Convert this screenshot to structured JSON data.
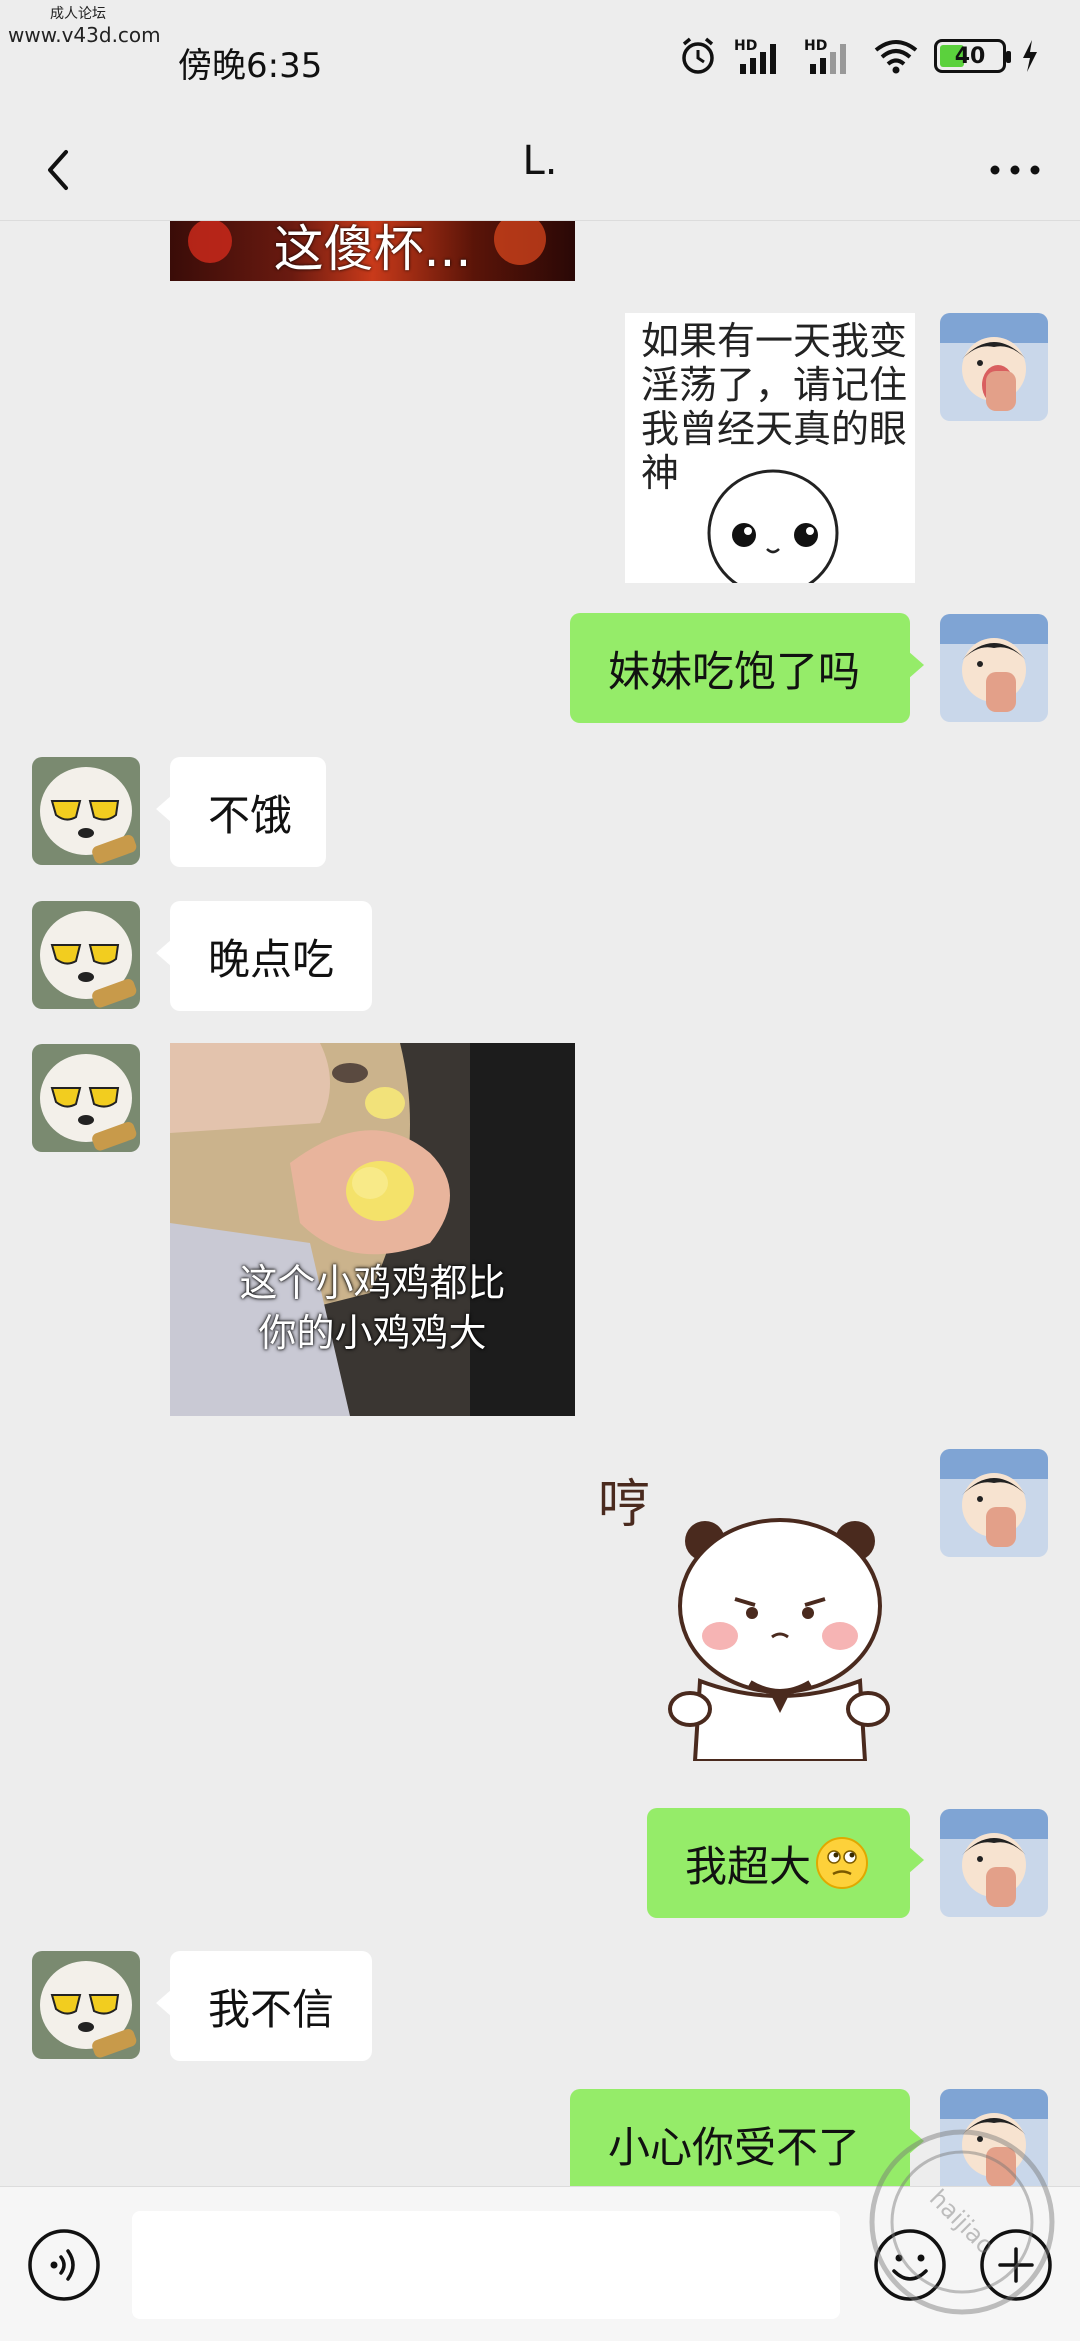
{
  "watermark": {
    "cn": "成人论坛",
    "url": "www.v43d.com"
  },
  "status_bar": {
    "time": "傍晚6:35",
    "signal_labels": [
      "HD",
      "HD"
    ],
    "battery": "40",
    "battery_fill_percent": 40
  },
  "header": {
    "title": "L."
  },
  "messages": {
    "top_sticker_caption": "这傻杯...",
    "sticker1_text": "如果有一天我变\n淫荡了，请记住\n我曾经天真的眼\n神",
    "m1": "妹妹吃饱了吗",
    "m2": "不饿",
    "m3": "晚点吃",
    "photo_caption": "这个小鸡鸡都比\n你的小鸡鸡大",
    "sticker2_text": "哼",
    "m4": "我超大",
    "m5": "我不信",
    "m6": "小心你受不了"
  },
  "input": {
    "placeholder": ""
  },
  "stamp": {
    "text": "haijiao"
  },
  "colors": {
    "outgoing_bubble": "#95ec69",
    "incoming_bubble": "#ffffff",
    "background": "#ededed"
  }
}
